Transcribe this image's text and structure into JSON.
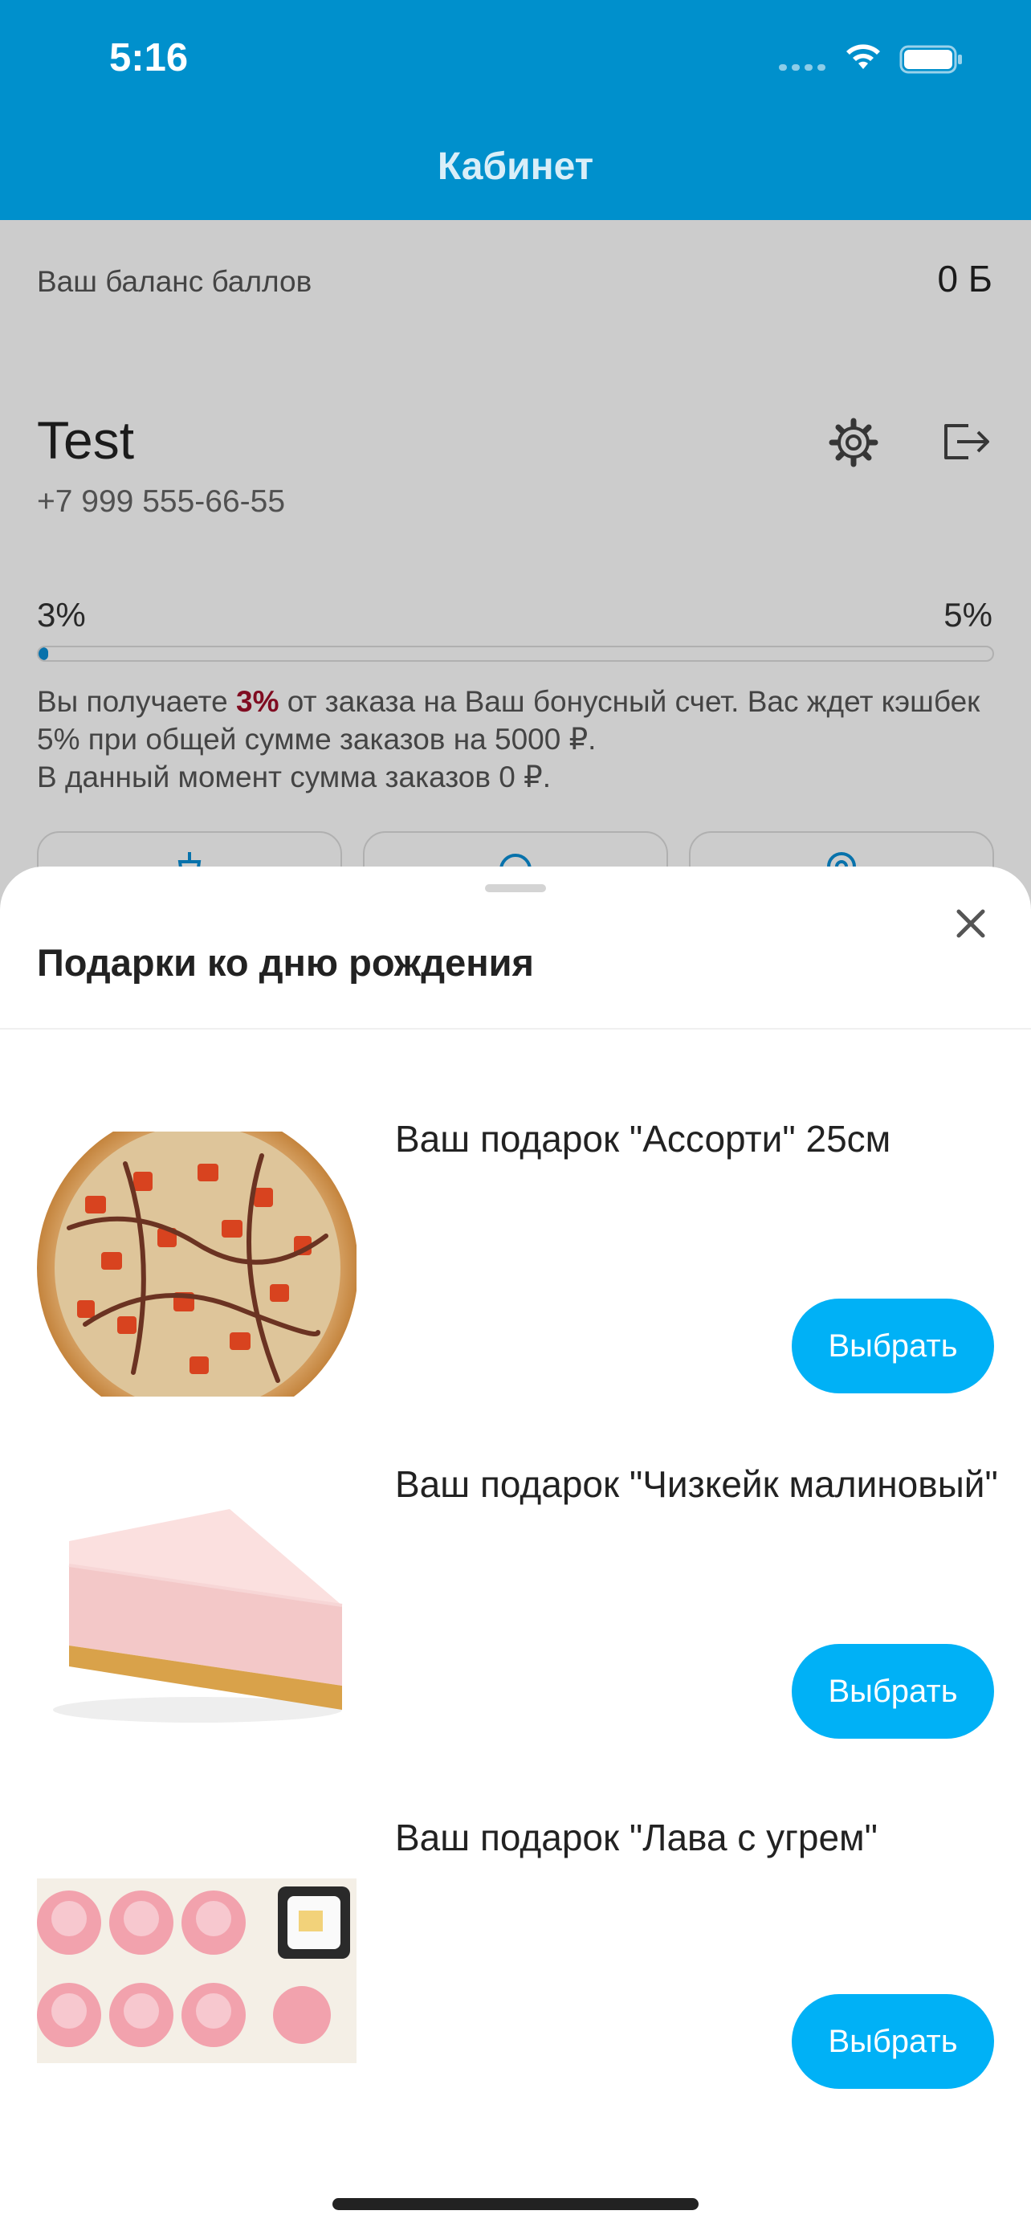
{
  "status": {
    "time": "5:16"
  },
  "nav": {
    "title": "Кабинет"
  },
  "account": {
    "balance_label": "Ваш баланс баллов",
    "balance_value": "0 Б",
    "name": "Test",
    "phone": "+7 999 555-66-55",
    "cashback_min": "3%",
    "cashback_max": "5%",
    "progress_fraction": 0.01,
    "text_prefix": "Вы получаете ",
    "text_highlight": "3%",
    "text_rest": " от заказа на Ваш бонусный счет. Вас ждет кэшбек 5% при общей сумме заказов на 5000 ₽.",
    "text_line3": "В данный момент сумма заказов 0 ₽."
  },
  "sheet": {
    "title": "Подарки ко дню рождения",
    "gifts": [
      {
        "name": "Ваш подарок \"Ассорти\" 25см",
        "button": "Выбрать",
        "image": "pizza"
      },
      {
        "name": "Ваш подарок \"Чизкейк малиновый\"",
        "button": "Выбрать",
        "image": "cheesecake"
      },
      {
        "name": "Ваш подарок \"Лава с угрем\"",
        "button": "Выбрать",
        "image": "sushi"
      }
    ]
  },
  "colors": {
    "header": "#0090cc",
    "button": "#00b1f6",
    "highlight": "#a0102a"
  }
}
